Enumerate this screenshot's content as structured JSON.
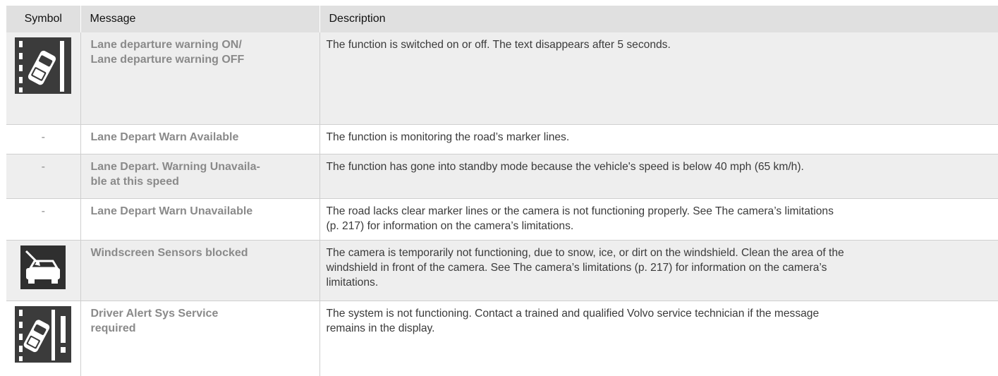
{
  "headers": {
    "symbol": "Symbol",
    "message": "Message",
    "description": "Description"
  },
  "rows": [
    {
      "symbol_icon": "lane-departure-icon",
      "message_line1": "Lane departure warning ON/",
      "message_line2": "Lane departure warning OFF",
      "description": "The function is switched on or off. The text disappears after 5 seconds."
    },
    {
      "symbol_text": "-",
      "message_line1": "Lane Depart Warn Available",
      "description": "The function is monitoring the road’s marker lines."
    },
    {
      "symbol_text": "-",
      "message_line1": "Lane Depart. Warning Unavaila-",
      "message_line2": "ble at this speed",
      "description": "The function has gone into standby mode because the vehicle's speed is below 40 mph (65 km/h)."
    },
    {
      "symbol_text": "-",
      "message_line1": "Lane Depart Warn Unavailable",
      "description_line1": "The road lacks clear marker lines or the camera is not functioning properly. See The camera’s limitations",
      "description_line2": "(p. 217) for information on the camera’s limitations."
    },
    {
      "symbol_icon": "windscreen-sensor-blocked-icon",
      "message_line1": "Windscreen Sensors blocked",
      "description_line1": "The camera is temporarily not functioning, due to snow, ice, or dirt on the windshield. Clean the area of the",
      "description_line2": "windshield in front of the camera. See The camera’s limitations (p. 217) for information on the camera’s",
      "description_line3": "limitations."
    },
    {
      "symbol_icon": "lane-departure-service-icon",
      "message_line1": "Driver Alert Sys Service",
      "message_line2": "required",
      "description_line1": "The system is not functioning. Contact a trained and qualified Volvo service technician if the message",
      "description_line2": "remains in the display."
    }
  ]
}
